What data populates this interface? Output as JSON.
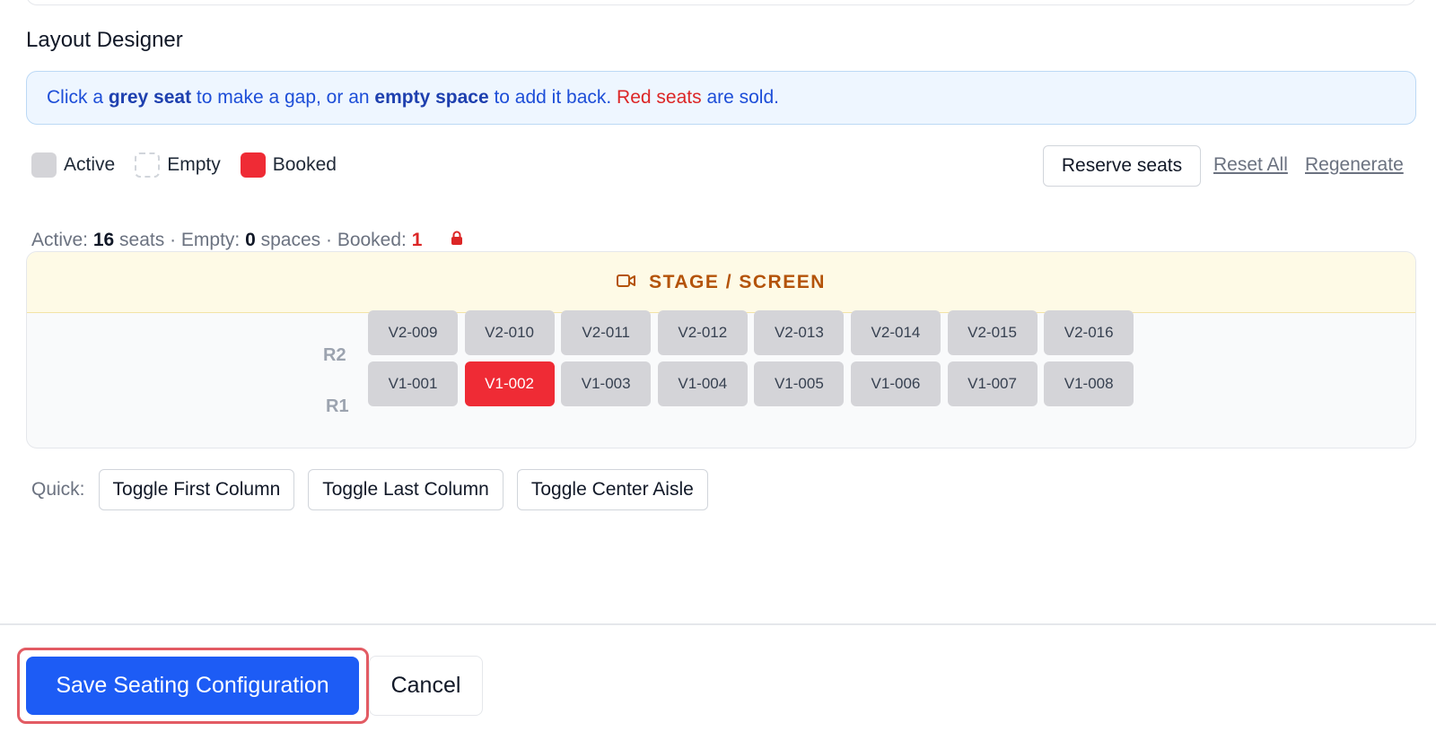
{
  "section_title": "Layout Designer",
  "banner": {
    "t1": "Click a ",
    "b1": "grey seat",
    "t2": " to make a gap, or an ",
    "b2": "empty space",
    "t3": " to add it back. ",
    "red": "Red seats",
    "t4": " are sold."
  },
  "legend": {
    "active": "Active",
    "empty": "Empty",
    "booked": "Booked"
  },
  "actions": {
    "reserve": "Reserve seats",
    "reset_all": "Reset All",
    "regenerate": "Regenerate"
  },
  "stats": {
    "active_label": "Active: ",
    "active_count": "16",
    "active_unit": " seats · Empty: ",
    "empty_count": "0",
    "empty_unit": " spaces · Booked: ",
    "booked_count": "1"
  },
  "stage_label": "STAGE / SCREEN",
  "rows": [
    {
      "label": "R2",
      "seats": [
        {
          "id": "V2-009",
          "status": "active"
        },
        {
          "id": "V2-010",
          "status": "active"
        },
        {
          "id": "V2-011",
          "status": "active"
        },
        {
          "id": "V2-012",
          "status": "active"
        },
        {
          "id": "V2-013",
          "status": "active"
        },
        {
          "id": "V2-014",
          "status": "active"
        },
        {
          "id": "V2-015",
          "status": "active"
        },
        {
          "id": "V2-016",
          "status": "active"
        }
      ]
    },
    {
      "label": "R1",
      "seats": [
        {
          "id": "V1-001",
          "status": "active"
        },
        {
          "id": "V1-002",
          "status": "booked"
        },
        {
          "id": "V1-003",
          "status": "active"
        },
        {
          "id": "V1-004",
          "status": "active"
        },
        {
          "id": "V1-005",
          "status": "active"
        },
        {
          "id": "V1-006",
          "status": "active"
        },
        {
          "id": "V1-007",
          "status": "active"
        },
        {
          "id": "V1-008",
          "status": "active"
        }
      ]
    }
  ],
  "quick": {
    "label": "Quick:",
    "buttons": [
      "Toggle First Column",
      "Toggle Last Column",
      "Toggle Center Aisle"
    ]
  },
  "footer": {
    "save": "Save Seating Configuration",
    "cancel": "Cancel"
  },
  "colors": {
    "primary": "#1d5cf5",
    "booked": "#ef2b35",
    "active_seat": "#d4d4d8",
    "stage_text": "#b45309"
  },
  "icons": {
    "stage": "video-camera-icon",
    "lock": "lock-icon"
  }
}
